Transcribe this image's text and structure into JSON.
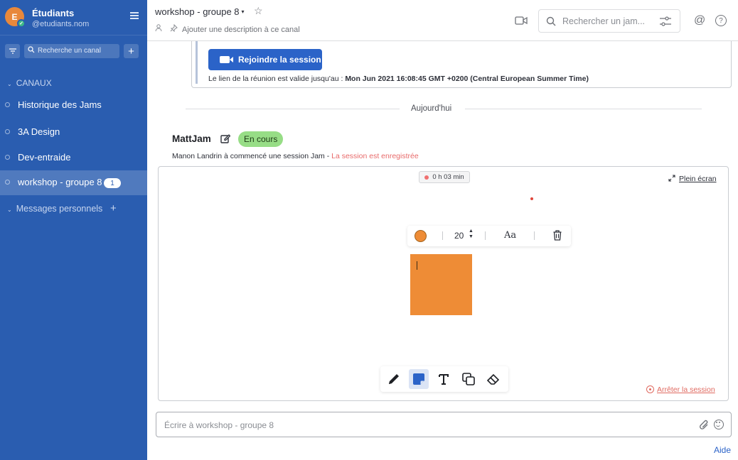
{
  "sidebar": {
    "team_initial": "E",
    "team_name": "Étudiants",
    "team_handle": "@etudiants.nom",
    "search_placeholder": "Recherche un canal",
    "add_label": "+",
    "section_channels": "CANAUX",
    "channels": [
      {
        "label": "Historique des Jams",
        "active": false
      },
      {
        "label": "3A Design",
        "active": false
      },
      {
        "label": "Dev-entraide",
        "active": false
      },
      {
        "label": "workshop - groupe 8",
        "active": true,
        "badge": "1"
      }
    ],
    "section_dm": "Messages personnels",
    "dm_add": "+"
  },
  "header": {
    "channel_title": "workshop - groupe 8",
    "description": "Ajouter une description à ce canal",
    "search_placeholder": "Rechercher un jam...",
    "at_symbol": "@",
    "help_symbol": "?"
  },
  "meeting": {
    "join_label": "Rejoindre la session",
    "validity_prefix": "Le lien de la réunion est valide jusqu'au : ",
    "validity_date": "Mon Jun 2021 16:08:45 GMT +0200 (Central European Summer Time)"
  },
  "date_separator": "Aujourd'hui",
  "post": {
    "author": "MattJam",
    "status": "En cours",
    "text": "Manon Landrin à commencé une session Jam - ",
    "recorded": "La session est enregistrée"
  },
  "board": {
    "timer": "0 h 03 min",
    "fullscreen": "Plein écran",
    "font_size": "20",
    "font_button": "Aa",
    "sticky_color": "#ee8c36",
    "stop_session": "Arrêter la session",
    "tools": [
      "pencil-icon",
      "sticky-note-icon",
      "text-icon",
      "shapes-icon",
      "eraser-icon"
    ]
  },
  "composer": {
    "placeholder": "Écrire à workshop - groupe 8"
  },
  "help_link": "Aide",
  "colors": {
    "sidebar": "#2a5db0",
    "accent": "#2b63c8",
    "status_pill": "#97dd86",
    "record": "#e86a6a"
  }
}
